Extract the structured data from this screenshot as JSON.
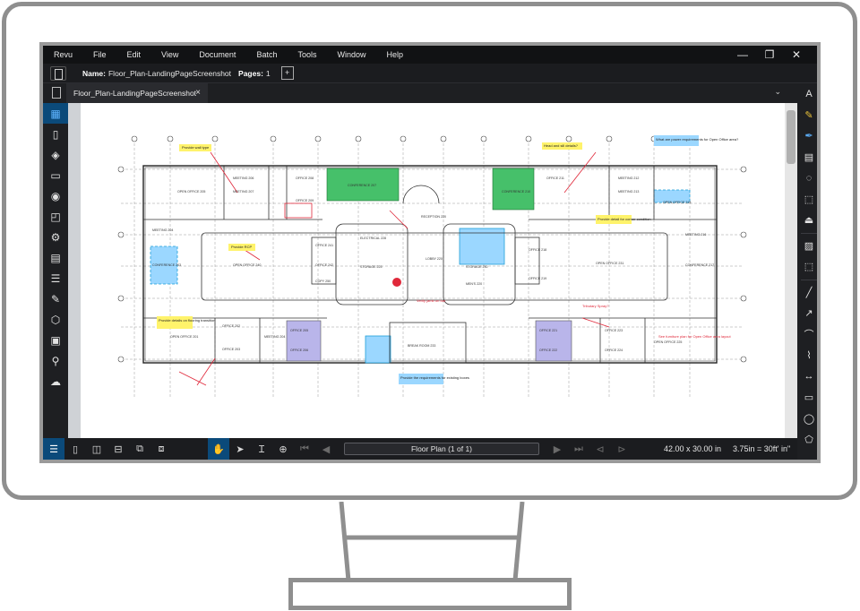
{
  "menu": [
    "Revu",
    "File",
    "Edit",
    "View",
    "Document",
    "Batch",
    "Tools",
    "Window",
    "Help"
  ],
  "window_controls": {
    "minimize": "—",
    "restore": "❐",
    "close": "✕"
  },
  "properties": {
    "name_label": "Name:",
    "name_value": "Floor_Plan-LandingPageScreenshot",
    "pages_label": "Pages:",
    "pages_value": "1"
  },
  "tab": {
    "title": "Floor_Plan-LandingPageScreenshot",
    "close": "×",
    "chevron": "⌄"
  },
  "left_sidebar": [
    "thumbnails-icon",
    "bookmarks-icon",
    "layers-icon",
    "toolchest-icon",
    "places-icon",
    "file-access-icon",
    "properties-icon",
    "measurements-icon",
    "markups-list-icon",
    "signatures-icon",
    "tags-icon",
    "studio-icon",
    "search-icon",
    "cloud-icon"
  ],
  "right_sidebar": [
    "text-box-icon",
    "highlight-icon",
    "pen-icon",
    "stamp-icon",
    "cloud-markup-icon",
    "callout-icon",
    "signature-stamp-icon",
    "image-icon",
    "snapshot-icon",
    "line-icon",
    "arrow-icon",
    "arc-icon",
    "polyline-icon",
    "dimension-icon",
    "rectangle-icon",
    "ellipse-icon",
    "polygon-icon"
  ],
  "status": {
    "page_field": "Floor Plan (1 of 1)",
    "dimensions": "42.00 x 30.00 in",
    "scale": "3.75in = 30ft' in\""
  },
  "plan": {
    "rooms_top": [
      "OPEN OFFICE 205",
      "MEETING 206",
      "MEETING 207",
      "OFFICE 208",
      "OFFICE 209",
      "CONFERENCE 207",
      "RECEPTION 220",
      "CONFERENCE 210",
      "OFFICE 211",
      "MEETING 212",
      "MEETING 213",
      "OPEN OFFICE 215"
    ],
    "rooms_mid": [
      "MEETING 204",
      "CONFERENCE 203",
      "OPEN OFFICE 240",
      "OFFICE 241",
      "OFFICE 242",
      "COPY 250",
      "ELECTRICAL 228",
      "STORAGE 225",
      "LOBBY 220",
      "MEN'S 220",
      "STORAGE 230",
      "OFFICE 218",
      "OFFICE 219",
      "OPEN OFFICE 231",
      "MEETING 216",
      "CONFERENCE 217"
    ],
    "rooms_bottom": [
      "OPEN OFFICE 201",
      "OFFICE 202",
      "OFFICE 203",
      "MEETING 204",
      "OFFICE 205",
      "OFFICE 206",
      "BREAK ROOM 233",
      "OFFICE 221",
      "OFFICE 222",
      "OFFICE 223",
      "OFFICE 224",
      "OPEN OFFICE 225"
    ],
    "notes": [
      "Provide wall type",
      "Provide RCP",
      "Provide details on flooring transition",
      "Provide detail for corner condition",
      "Head and sill details?",
      "What are power requirements for Open Office area?",
      "Verify jamb on bar",
      "Provide the requirements for existing boxes",
      "Tributary Spray?",
      "See furniture plan for Open Office area layout"
    ],
    "note_colors": {
      "yellow": "#fff36b",
      "green": "#46c06a",
      "blue": "#9bd7ff",
      "purple": "#b9b5ea",
      "red": "#e0283a",
      "cyan": "#1e9fd8"
    }
  }
}
